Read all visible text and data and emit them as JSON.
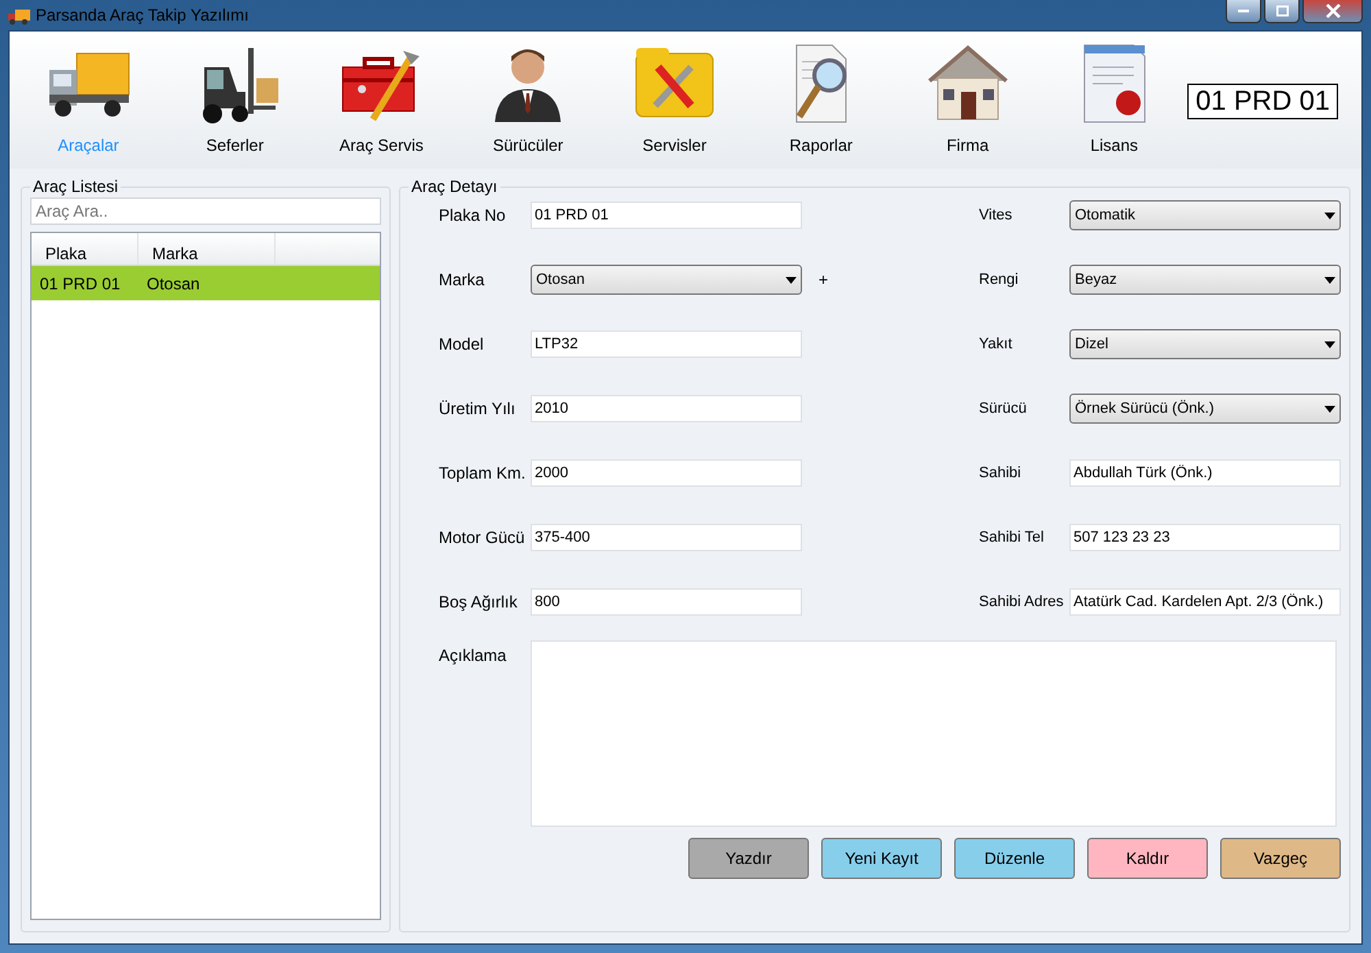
{
  "window": {
    "title": "Parsanda Araç Takip Yazılımı"
  },
  "toolbar": [
    {
      "label": "Araçalar",
      "selected": true
    },
    {
      "label": "Seferler",
      "selected": false
    },
    {
      "label": "Araç Servis",
      "selected": false
    },
    {
      "label": "Sürücüler",
      "selected": false
    },
    {
      "label": "Servisler",
      "selected": false
    },
    {
      "label": "Raporlar",
      "selected": false
    },
    {
      "label": "Firma",
      "selected": false
    },
    {
      "label": "Lisans",
      "selected": false
    }
  ],
  "plate_display": "01 PRD 01",
  "vehicle_list": {
    "title": "Araç Listesi",
    "search": {
      "placeholder": "Araç Ara.."
    },
    "columns": [
      "Plaka",
      "Marka"
    ],
    "rows": [
      {
        "cells": [
          "01 PRD 01",
          "Otosan"
        ],
        "selected": true
      }
    ]
  },
  "detail": {
    "title": "Araç Detayı",
    "left_fields": [
      {
        "label": "Plaka No",
        "kind": "text",
        "value": "01 PRD 01"
      },
      {
        "label": "Marka",
        "kind": "select",
        "value": "Otosan",
        "extra": "+"
      },
      {
        "label": "Model",
        "kind": "text",
        "value": "LTP32"
      },
      {
        "label": "Üretim Yılı",
        "kind": "text",
        "value": "2010"
      },
      {
        "label": "Toplam Km.",
        "kind": "text",
        "value": "2000"
      },
      {
        "label": "Motor Gücü",
        "kind": "text",
        "value": "375-400"
      },
      {
        "label": "Boş Ağırlık",
        "kind": "text",
        "value": "800"
      }
    ],
    "right_fields": [
      {
        "label": "Vites",
        "kind": "select",
        "value": "Otomatik"
      },
      {
        "label": "Rengi",
        "kind": "select",
        "value": "Beyaz"
      },
      {
        "label": "Yakıt",
        "kind": "select",
        "value": "Dizel"
      },
      {
        "label": "Sürücü",
        "kind": "select",
        "value": "Örnek Sürücü  (Önk.)"
      },
      {
        "label": "Sahibi",
        "kind": "text",
        "value": "Abdullah Türk (Önk.)"
      },
      {
        "label": "Sahibi Tel",
        "kind": "text",
        "value": "507 123 23 23"
      },
      {
        "label": "Sahibi Adres",
        "kind": "text",
        "value": "Atatürk Cad. Kardelen Apt. 2/3 (Önk.)"
      }
    ],
    "description": {
      "label": "Açıklama"
    },
    "buttons": [
      {
        "label": "Yazdır",
        "color": "#a9a9a9"
      },
      {
        "label": "Yeni Kayıt",
        "color": "#87ceeb"
      },
      {
        "label": "Düzenle",
        "color": "#87ceeb"
      },
      {
        "label": "Kaldır",
        "color": "#ffb6c1"
      },
      {
        "label": "Vazgeç",
        "color": "#deb887"
      }
    ]
  }
}
